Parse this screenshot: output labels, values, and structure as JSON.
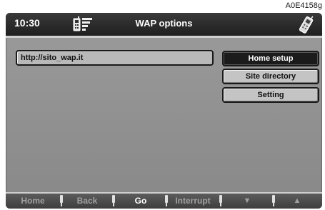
{
  "figure_code": "A0E4158g",
  "status": {
    "time": "10:30",
    "title": "WAP options"
  },
  "icons": {
    "signal": "phone-signal-icon",
    "phone": "handset-icon"
  },
  "url": {
    "value": "http://sito_wap.it"
  },
  "menu": {
    "items": [
      {
        "label": "Home setup",
        "selected": true
      },
      {
        "label": "Site directory",
        "selected": false
      },
      {
        "label": "Setting",
        "selected": false
      }
    ]
  },
  "softkeys": {
    "items": [
      {
        "label": "Home",
        "active": false
      },
      {
        "label": "Back",
        "active": false
      },
      {
        "label": "Go",
        "active": true
      },
      {
        "label": "Interrupt",
        "active": false
      },
      {
        "label": "▼",
        "active": false
      },
      {
        "label": "▲",
        "active": false
      }
    ]
  },
  "colors": {
    "screen_bg": "#9b9b9b",
    "titlebar_bg": "#2a2a2a",
    "selected_bg": "#1b1b1b",
    "button_bg": "#c4c4c4"
  }
}
